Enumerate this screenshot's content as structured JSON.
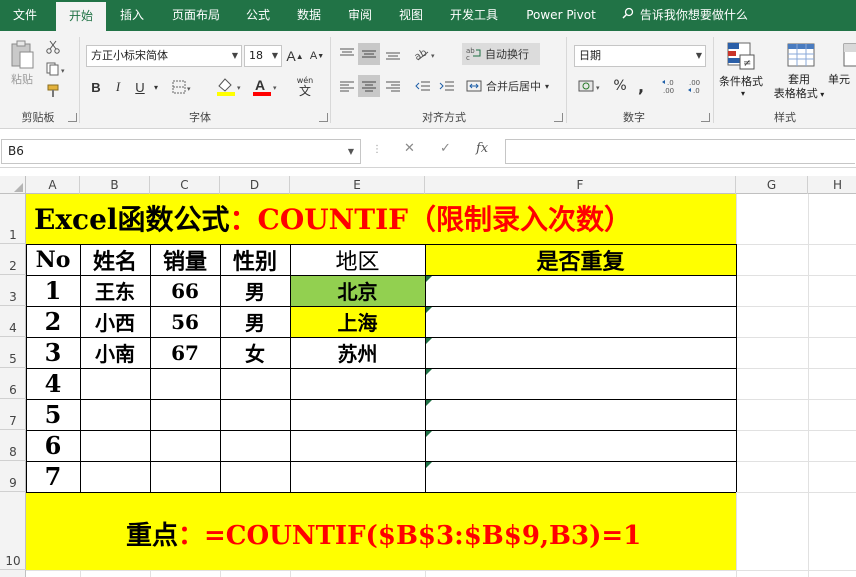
{
  "ribbon_tabs": [
    "文件",
    "开始",
    "插入",
    "页面布局",
    "公式",
    "数据",
    "审阅",
    "视图",
    "开发工具",
    "Power Pivot"
  ],
  "active_tab": "开始",
  "tell_me": "告诉我你想要做什么",
  "ribbon": {
    "clipboard": {
      "paste_label": "粘贴",
      "group_label": "剪贴板"
    },
    "font": {
      "font_name": "方正小标宋简体",
      "font_size": "18",
      "bold": "B",
      "italic": "I",
      "underline": "U",
      "font_color_letter": "A",
      "wen": "wén",
      "grow": "A",
      "shrink": "A",
      "group_label": "字体"
    },
    "alignment": {
      "wrap_text": "自动换行",
      "merge_center": "合并后居中",
      "group_label": "对齐方式"
    },
    "number": {
      "format": "日期",
      "percent": "%",
      "comma": ",",
      "dec_inc": "←.0\n.00",
      "dec_dec": ".00\n→.0",
      "group_label": "数字"
    },
    "styles": {
      "conditional": "条件格式",
      "table_line1": "套用",
      "table_line2": "表格格式",
      "cell_styles": "单元",
      "group_label": "样式"
    }
  },
  "formula_bar": {
    "name_box": "B6",
    "cancel": "✕",
    "confirm": "✓",
    "fx": "fx",
    "formula": ""
  },
  "columns": [
    "A",
    "B",
    "C",
    "D",
    "E",
    "F",
    "G",
    "H"
  ],
  "rows": [
    "1",
    "2",
    "3",
    "4",
    "5",
    "6",
    "7",
    "8",
    "9",
    "10"
  ],
  "sheet": {
    "title_black": "Excel函数公式",
    "title_red": "：COUNTIF（限制录入次数）",
    "headers": {
      "no": "No",
      "name": "姓名",
      "sales": "销量",
      "gender": "性别",
      "region": "地区",
      "duplicate": "是否重复"
    },
    "data_rows": [
      {
        "no": "1",
        "name": "王东",
        "sales": "66",
        "gender": "男",
        "region": "北京",
        "duplicate": ""
      },
      {
        "no": "2",
        "name": "小西",
        "sales": "56",
        "gender": "男",
        "region": "上海",
        "duplicate": ""
      },
      {
        "no": "3",
        "name": "小南",
        "sales": "67",
        "gender": "女",
        "region": "苏州",
        "duplicate": ""
      },
      {
        "no": "4",
        "name": "",
        "sales": "",
        "gender": "",
        "region": "",
        "duplicate": ""
      },
      {
        "no": "5",
        "name": "",
        "sales": "",
        "gender": "",
        "region": "",
        "duplicate": ""
      },
      {
        "no": "6",
        "name": "",
        "sales": "",
        "gender": "",
        "region": "",
        "duplicate": ""
      },
      {
        "no": "7",
        "name": "",
        "sales": "",
        "gender": "",
        "region": "",
        "duplicate": ""
      }
    ],
    "note_black": "重点",
    "note_red": "：=COUNTIF($B$3:$B$9,B3)=1"
  },
  "colors": {
    "excel_green": "#217346",
    "highlight_yellow": "#ffff00",
    "highlight_green": "#92d050",
    "text_red": "#ff0000"
  },
  "icons": [
    "cut-icon",
    "copy-icon",
    "format-painter-icon",
    "search-icon",
    "align-icons",
    "orientation-icon",
    "currency-icon",
    "conditional-format-icon",
    "table-format-icon"
  ]
}
